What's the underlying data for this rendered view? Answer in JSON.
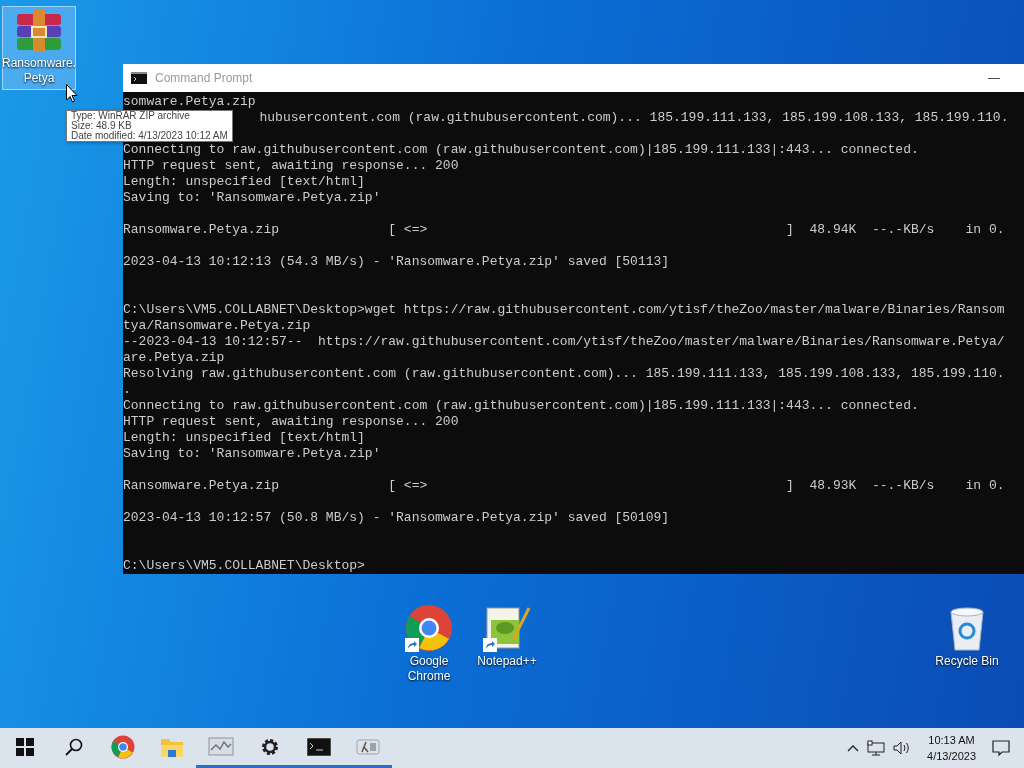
{
  "desktop_icons": [
    {
      "kind": "archive",
      "label_lines": [
        "Ransomware.",
        "Petya"
      ],
      "selected": true,
      "shortcut": false
    },
    {
      "kind": "chrome",
      "label_lines": [
        "Google",
        "Chrome"
      ],
      "selected": false,
      "shortcut": true
    },
    {
      "kind": "notepad",
      "label_lines": [
        "Notepad++"
      ],
      "selected": false,
      "shortcut": true
    },
    {
      "kind": "recycle",
      "label_lines": [
        "Recycle Bin"
      ],
      "selected": false,
      "shortcut": false
    }
  ],
  "window": {
    "title": "Command Prompt",
    "active": false,
    "minimize": "—",
    "lines": [
      {
        "kind": "text",
        "text": "somware.Petya.zip"
      },
      {
        "kind": "cut",
        "text": "hubusercontent.com (raw.githubusercontent.com)... 185.199.111.133, 185.199.108.133, 185.199.110."
      },
      {
        "kind": "blank"
      },
      {
        "kind": "text",
        "text": "Connecting to raw.githubusercontent.com (raw.githubusercontent.com)|185.199.111.133|:443... connected."
      },
      {
        "kind": "text",
        "text": "HTTP request sent, awaiting response... 200"
      },
      {
        "kind": "text",
        "text": "Length: unspecified [text/html]"
      },
      {
        "kind": "text",
        "text": "Saving to: 'Ransomware.Petya.zip'"
      },
      {
        "kind": "blank"
      },
      {
        "kind": "text",
        "text": "Ransomware.Petya.zip              [ <=>                                              ]  48.94K  --.-KB/s    in 0."
      },
      {
        "kind": "blank"
      },
      {
        "kind": "text",
        "text": "2023-04-13 10:12:13 (54.3 MB/s) - 'Ransomware.Petya.zip' saved [50113]"
      },
      {
        "kind": "blank"
      },
      {
        "kind": "blank"
      },
      {
        "kind": "text",
        "text": "C:\\Users\\VM5.COLLABNET\\Desktop>wget https://raw.githubusercontent.com/ytisf/theZoo/master/malware/Binaries/Ransom"
      },
      {
        "kind": "text",
        "text": "tya/Ransomware.Petya.zip"
      },
      {
        "kind": "text",
        "text": "--2023-04-13 10:12:57--  https://raw.githubusercontent.com/ytisf/theZoo/master/malware/Binaries/Ransomware.Petya/"
      },
      {
        "kind": "text",
        "text": "are.Petya.zip"
      },
      {
        "kind": "text",
        "text": "Resolving raw.githubusercontent.com (raw.githubusercontent.com)... 185.199.111.133, 185.199.108.133, 185.199.110."
      },
      {
        "kind": "text",
        "text": "."
      },
      {
        "kind": "text",
        "text": "Connecting to raw.githubusercontent.com (raw.githubusercontent.com)|185.199.111.133|:443... connected."
      },
      {
        "kind": "text",
        "text": "HTTP request sent, awaiting response... 200"
      },
      {
        "kind": "text",
        "text": "Length: unspecified [text/html]"
      },
      {
        "kind": "text",
        "text": "Saving to: 'Ransomware.Petya.zip'"
      },
      {
        "kind": "blank"
      },
      {
        "kind": "text",
        "text": "Ransomware.Petya.zip              [ <=>                                              ]  48.93K  --.-KB/s    in 0."
      },
      {
        "kind": "blank"
      },
      {
        "kind": "text",
        "text": "2023-04-13 10:12:57 (50.8 MB/s) - 'Ransomware.Petya.zip' saved [50109]"
      },
      {
        "kind": "blank"
      },
      {
        "kind": "blank"
      },
      {
        "kind": "text",
        "text": "C:\\Users\\VM5.COLLABNET\\Desktop>"
      }
    ]
  },
  "tooltip": {
    "lines": [
      "Type: WinRAR ZIP archive",
      "Size: 48.9 KB",
      "Date modified: 4/13/2023 10:12 AM"
    ]
  },
  "taskbar": {
    "items": [
      {
        "kind": "start",
        "running": false
      },
      {
        "kind": "search",
        "running": false
      },
      {
        "kind": "chrome",
        "running": false
      },
      {
        "kind": "explorer",
        "running": false
      },
      {
        "kind": "monitor",
        "running": true
      },
      {
        "kind": "settings",
        "running": true
      },
      {
        "kind": "cmd",
        "running": true
      },
      {
        "kind": "lambda",
        "running": true
      }
    ],
    "time": "10:13 AM",
    "date": "4/13/2023"
  }
}
